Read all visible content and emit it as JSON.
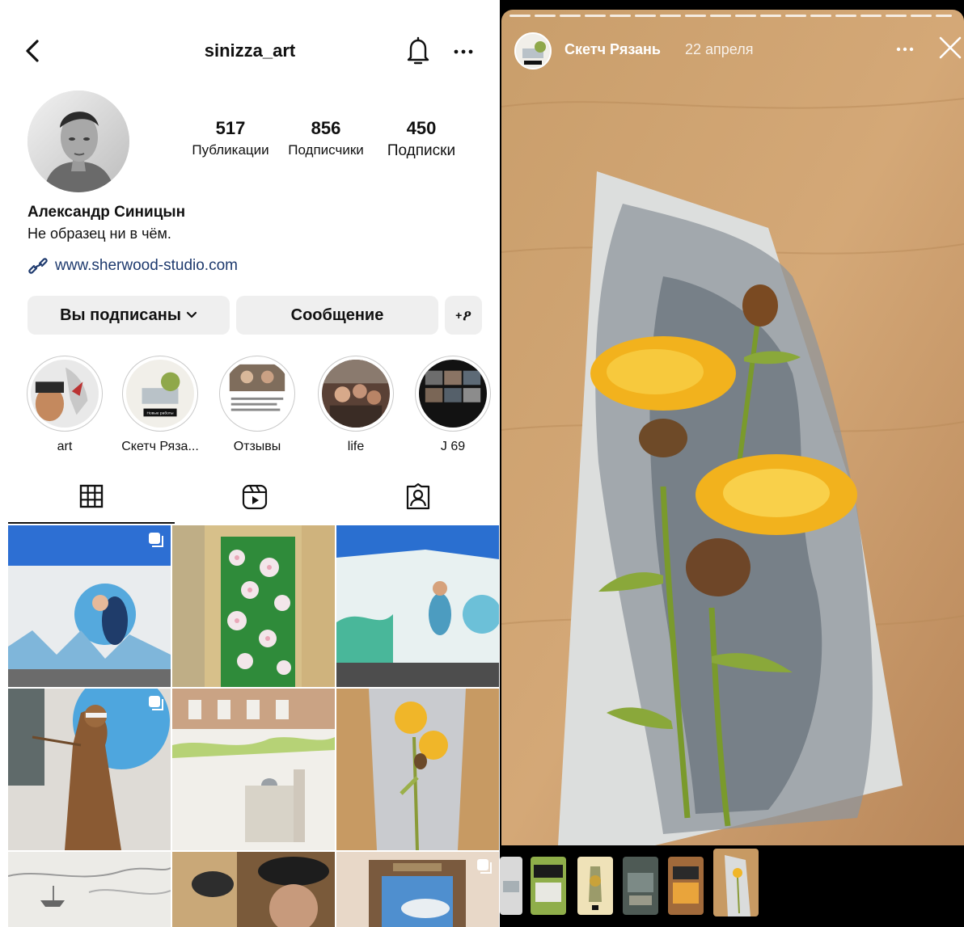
{
  "profile": {
    "username": "sinizza_art",
    "stats": [
      {
        "value": "517",
        "label": "Публикации"
      },
      {
        "value": "856",
        "label": "Подписчики"
      },
      {
        "value": "450",
        "label": "Подписки"
      }
    ],
    "full_name": "Александр Синицын",
    "bio": "Не образец ни в чём.",
    "website": "www.sherwood-studio.com",
    "buttons": {
      "following": "Вы подписаны",
      "message": "Сообщение",
      "add_user": "+",
      "add_user_glyph": "ዖ"
    },
    "highlights": [
      {
        "label": "art"
      },
      {
        "label": "Скетч Рязань"
      },
      {
        "label": "Отзывы"
      },
      {
        "label": "life"
      },
      {
        "label": "J 69"
      }
    ],
    "highlight_display": [
      "art",
      "Скетч Ряза...",
      "Отзывы",
      "life",
      "J 69"
    ],
    "highlight_sticker": "Новые работы"
  },
  "story": {
    "user": "Скетч Рязань",
    "date": "22 апреля"
  },
  "colors": {
    "link": "#1e3a6e",
    "button_bg": "#efefef",
    "story_bg": "#000000"
  }
}
